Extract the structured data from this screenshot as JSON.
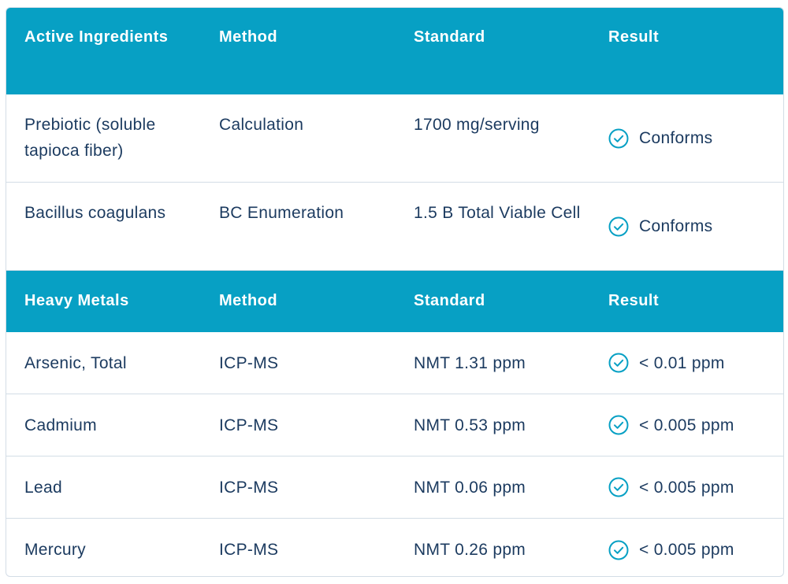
{
  "colors": {
    "header_bg": "#07a0c4",
    "text": "#1b3a5f",
    "check": "#07a0c4",
    "border": "#d3dde6"
  },
  "active_section": {
    "headers": [
      "Active Ingredients",
      "Method",
      "Standard",
      "Result"
    ],
    "rows": [
      {
        "ingredient": "Prebiotic (soluble tapioca fiber)",
        "method": "Calculation",
        "standard": "1700 mg/serving",
        "result": "Conforms",
        "icon": "check-circle-icon"
      },
      {
        "ingredient": "Bacillus coagulans",
        "method": "BC Enumeration",
        "standard": "1.5 B Total Viable Cell",
        "result": "Conforms",
        "icon": "check-circle-icon"
      }
    ]
  },
  "metals_section": {
    "headers": [
      "Heavy Metals",
      "Method",
      "Standard",
      "Result"
    ],
    "rows": [
      {
        "metal": "Arsenic, Total",
        "method": "ICP-MS",
        "standard": "NMT 1.31 ppm",
        "result": "< 0.01 ppm",
        "icon": "check-circle-icon"
      },
      {
        "metal": "Cadmium",
        "method": "ICP-MS",
        "standard": "NMT 0.53 ppm",
        "result": "< 0.005 ppm",
        "icon": "check-circle-icon"
      },
      {
        "metal": "Lead",
        "method": "ICP-MS",
        "standard": "NMT 0.06 ppm",
        "result": "< 0.005 ppm",
        "icon": "check-circle-icon"
      },
      {
        "metal": "Mercury",
        "method": "ICP-MS",
        "standard": "NMT 0.26 ppm",
        "result": "< 0.005 ppm",
        "icon": "check-circle-icon"
      }
    ]
  }
}
